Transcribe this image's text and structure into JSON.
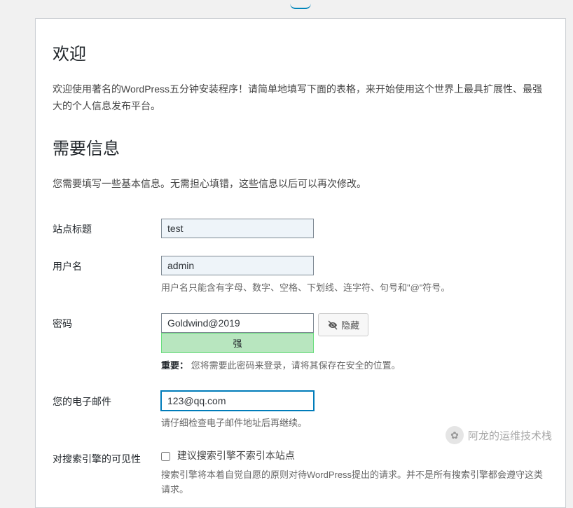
{
  "headings": {
    "welcome": "欢迎",
    "required_info": "需要信息"
  },
  "intro": {
    "welcome_text": "欢迎使用著名的WordPress五分钟安装程序！请简单地填写下面的表格，来开始使用这个世界上最具扩展性、最强大的个人信息发布平台。",
    "required_info_text": "您需要填写一些基本信息。无需担心填错，这些信息以后可以再次修改。"
  },
  "fields": {
    "site_title": {
      "label": "站点标题",
      "value": "test"
    },
    "username": {
      "label": "用户名",
      "value": "admin",
      "hint": "用户名只能含有字母、数字、空格、下划线、连字符、句号和\"@\"符号。"
    },
    "password": {
      "label": "密码",
      "value": "Goldwind@2019",
      "strength": "强",
      "hide_button": "隐藏",
      "important_label": "重要：",
      "important_text": "您将需要此密码来登录，请将其保存在安全的位置。"
    },
    "email": {
      "label": "您的电子邮件",
      "value": "123@qq.com",
      "hint": "请仔细检查电子邮件地址后再继续。"
    },
    "search_visibility": {
      "label": "对搜索引擎的可见性",
      "checkbox_label": "建议搜索引擎不索引本站点",
      "hint": "搜索引擎将本着自觉自愿的原则对待WordPress提出的请求。并不是所有搜索引擎都会遵守这类请求。"
    }
  },
  "watermark": {
    "text": "阿龙的运维技术栈"
  }
}
